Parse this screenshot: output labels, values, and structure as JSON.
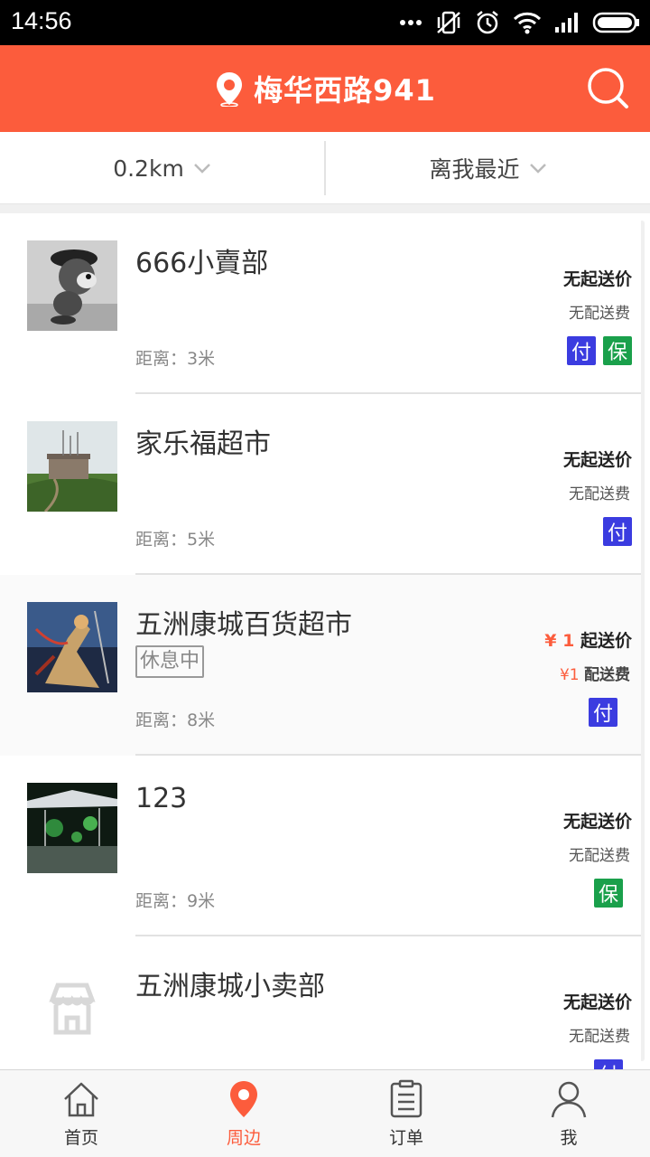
{
  "status_bar": {
    "time": "14:56"
  },
  "header": {
    "location": "梅华西路941"
  },
  "filters": {
    "distance": "0.2km",
    "sort": "离我最近"
  },
  "stores": [
    {
      "name": "666小賣部",
      "distance_label": "距离：3米",
      "min_price": "无起送价",
      "delivery_fee": "无配送费",
      "badges": [
        "付",
        "保"
      ]
    },
    {
      "name": "家乐福超市",
      "distance_label": "距离：5米",
      "min_price": "无起送价",
      "delivery_fee": "无配送费",
      "badges": [
        "付"
      ]
    },
    {
      "name": "五洲康城百货超市",
      "status": "休息中",
      "distance_label": "距离：8米",
      "min_price_amount": "¥ 1",
      "min_price_suffix": "起送价",
      "delivery_fee_amount": "¥1",
      "delivery_fee_suffix": "配送费",
      "badges": [
        "付"
      ]
    },
    {
      "name": "123",
      "distance_label": "距离：9米",
      "min_price": "无起送价",
      "delivery_fee": "无配送费",
      "badges": [
        "保"
      ]
    },
    {
      "name": "五洲康城小卖部",
      "min_price": "无起送价",
      "delivery_fee": "无配送费",
      "badges": [
        "付"
      ]
    }
  ],
  "bottom_nav": [
    {
      "label": "首页",
      "icon": "home-icon"
    },
    {
      "label": "周边",
      "icon": "location-pin-icon",
      "active": true
    },
    {
      "label": "订单",
      "icon": "order-list-icon"
    },
    {
      "label": "我",
      "icon": "user-icon"
    }
  ],
  "colors": {
    "accent": "#fc5c3c",
    "pay_badge": "#3b3ce0",
    "guarantee_badge": "#1aa04b"
  }
}
